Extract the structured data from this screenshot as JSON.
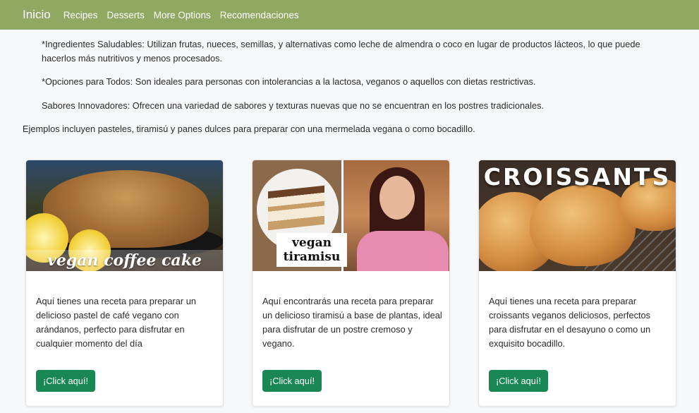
{
  "navbar": {
    "brand": "Inicio",
    "links": [
      "Recipes",
      "Desserts",
      "More Options",
      "Recomendaciones"
    ]
  },
  "content": {
    "p1": "*Ingredientes Saludables: Utilizan frutas, nueces, semillas, y alternativas como leche de almendra o coco en lugar de productos lácteos, lo que puede hacerlos más nutritivos y menos procesados.",
    "p2": "*Opciones para Todos: Son ideales para personas con intolerancias a la lactosa, veganos o aquellos con dietas restrictivas.",
    "p3": "Sabores Innovadores: Ofrecen una variedad de sabores y texturas nuevas que no se encuentran en los postres tradicionales.",
    "p4": "Ejemplos incluyen pasteles, tiramisú y panes dulces para preparar con una mermelada vegana o como bocadillo."
  },
  "cards": [
    {
      "image_caption": "vegan coffee cake",
      "text": "Aquí tienes una receta para preparar un delicioso pastel de café vegano con arándanos, perfecto para disfrutar en cualquier momento del día",
      "button": "¡Click aquí!"
    },
    {
      "image_caption": "vegan tiramisu",
      "text": "Aquí encontrarás una receta para preparar un delicioso tiramisú a base de plantas, ideal para disfrutar de un postre cremoso y vegano.",
      "button": "¡Click aquí!"
    },
    {
      "image_caption": "CROISSANTS",
      "text": "Aquí tienes una receta para preparar croissants veganos deliciosos, perfectos para disfrutar en el desayuno o como un exquisito bocadillo.",
      "button": "¡Click aquí!"
    }
  ],
  "colors": {
    "navbar": "#8fa862",
    "button": "#198754",
    "background": "#f7f8f9"
  }
}
